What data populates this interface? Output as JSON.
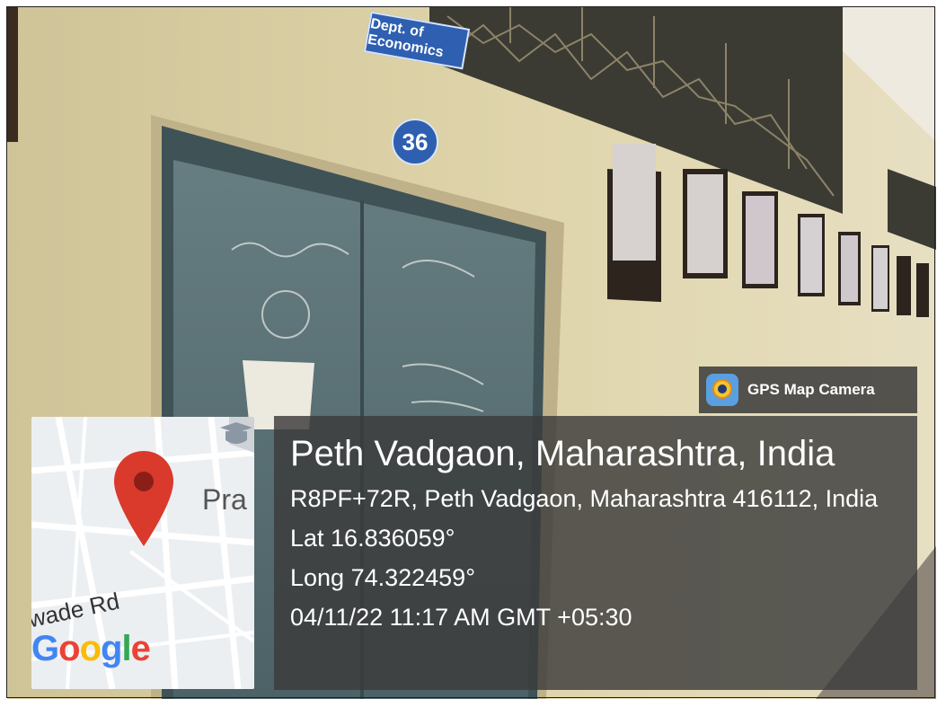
{
  "photo": {
    "door_sign": "Dept. of Economics",
    "room_number": "36"
  },
  "brand": {
    "icon": "gps-map-camera-app-icon",
    "name": "GPS Map Camera"
  },
  "map": {
    "place_label": "Pra",
    "road_label": "wade Rd",
    "logo": "Google",
    "pin_color": "#d93a2b"
  },
  "info": {
    "place": "Peth Vadgaon, Maharashtra, India",
    "address": "R8PF+72R, Peth Vadgaon, Maharashtra 416112, India",
    "lat": "Lat 16.836059°",
    "long": "Long 74.322459°",
    "datetime": "04/11/22 11:17 AM GMT +05:30"
  },
  "colors": {
    "overlay": "#3a3a3a",
    "wall": "#d9cfa6",
    "door": "#5e7478"
  }
}
